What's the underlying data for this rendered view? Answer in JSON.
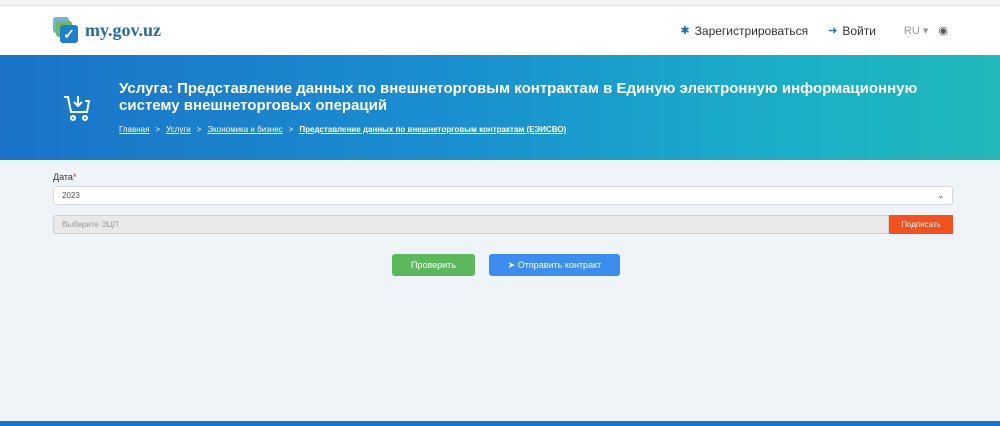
{
  "header": {
    "logo": "my.gov.uz",
    "register": "Зарегистрироваться",
    "login": "Войти",
    "lang": "RU ▾",
    "eye": "◉"
  },
  "banner": {
    "title": "Услуга: Представление данных по внешнеторговым контрактам в Единую электронную информационную систему внешнеторговых операций",
    "breadcrumbs": [
      "Главная",
      "Услуги",
      "Экономика и бизнес",
      "Представление данных по внешнеторговым контрактам (ЕЭИСВО)"
    ],
    "sep": ">"
  },
  "form": {
    "date_label": "Дата",
    "required": "*",
    "date_value": "2023",
    "chevron": "⌄",
    "esp_placeholder": "Выберите ЭЦП",
    "sign": "Подписать"
  },
  "actions": {
    "check": "Проверить",
    "send": "Отправить контракт"
  }
}
